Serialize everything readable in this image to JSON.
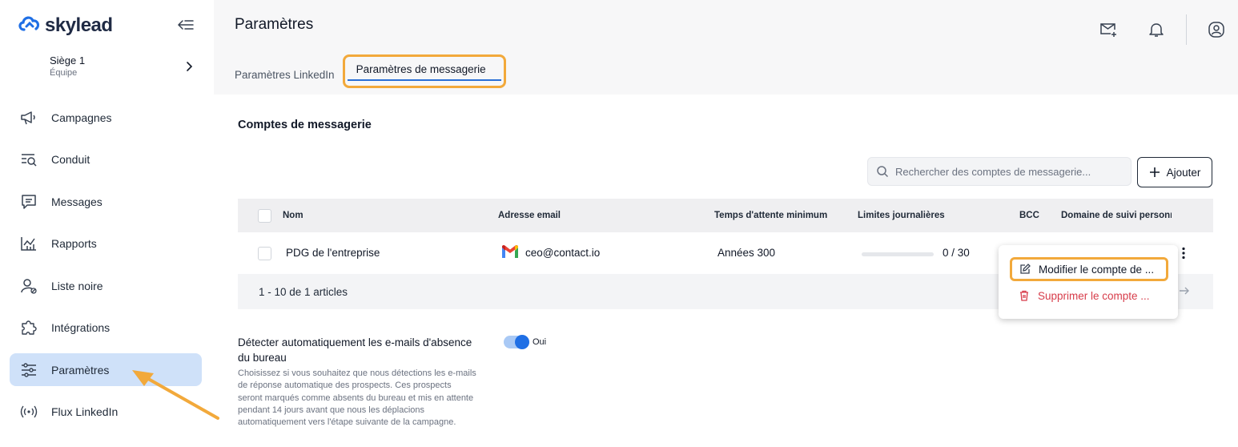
{
  "brand": {
    "name": "skylead"
  },
  "team": {
    "name": "Siège 1",
    "role": "Équipe"
  },
  "sidebar": {
    "items": [
      {
        "label": "Campagnes",
        "icon": "megaphone-icon"
      },
      {
        "label": "Conduit",
        "icon": "search-list-icon"
      },
      {
        "label": "Messages",
        "icon": "message-icon"
      },
      {
        "label": "Rapports",
        "icon": "chart-icon"
      },
      {
        "label": "Liste noire",
        "icon": "user-block-icon"
      },
      {
        "label": "Intégrations",
        "icon": "puzzle-icon"
      },
      {
        "label": "Paramètres",
        "icon": "sliders-icon",
        "active": true
      },
      {
        "label": "Flux LinkedIn",
        "icon": "broadcast-icon"
      }
    ]
  },
  "header": {
    "title": "Paramètres",
    "tabs": [
      {
        "label": "Paramètres LinkedIn",
        "active": false
      },
      {
        "label": "Paramètres de messagerie",
        "active": true
      }
    ]
  },
  "section": {
    "title": "Comptes de messagerie",
    "search_placeholder": "Rechercher des comptes de messagerie...",
    "add_label": "Ajouter"
  },
  "table": {
    "columns": [
      "Nom",
      "Adresse email",
      "Temps d'attente minimum",
      "Limites journalières",
      "BCC",
      "Domaine de suivi personn"
    ],
    "rows": [
      {
        "name": "PDG de l'entreprise",
        "email": "ceo@contact.io",
        "wait": "Années 300",
        "limit": "0 / 30",
        "limit_fraction": 0
      }
    ],
    "footer": "1 - 10 de 1 articles"
  },
  "menu": {
    "edit_label": "Modifier le compte de ...",
    "delete_label": "Supprimer le compte ..."
  },
  "setting": {
    "title": "Détecter automatiquement les e-mails d'absence du bureau",
    "description": "Choisissez si vous souhaitez que nous détections les e-mails de réponse automatique des prospects. Ces prospects seront marqués comme absents du bureau et mis en attente pendant 14 jours avant que nous les déplacions automatiquement vers l'étape suivante de la campagne.",
    "toggle_label": "Oui",
    "toggle_on": true
  },
  "colors": {
    "accent": "#2b6fd6",
    "highlight": "#f2a93b",
    "danger": "#d73c4a",
    "active_nav": "#cfe1f9"
  }
}
